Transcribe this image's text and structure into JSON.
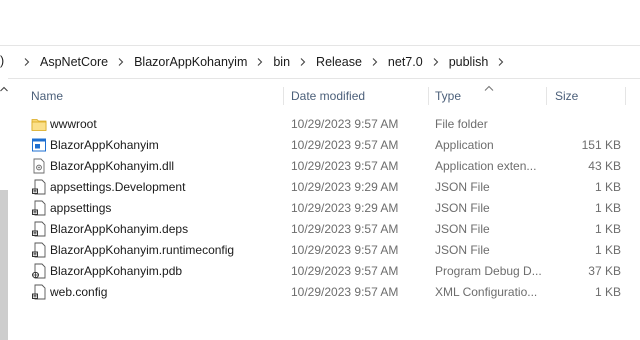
{
  "breadcrumb": {
    "lead": ")",
    "items": [
      "AspNetCore",
      "BlazorAppKohanyim",
      "bin",
      "Release",
      "net7.0",
      "publish"
    ]
  },
  "columns": {
    "name": "Name",
    "date": "Date modified",
    "type": "Type",
    "size": "Size"
  },
  "files": [
    {
      "name": "wwwroot",
      "date": "10/29/2023 9:57 AM",
      "type": "File folder",
      "size": "",
      "icon": "folder-icon"
    },
    {
      "name": "BlazorAppKohanyim",
      "date": "10/29/2023 9:57 AM",
      "type": "Application",
      "size": "151 KB",
      "icon": "application-icon"
    },
    {
      "name": "BlazorAppKohanyim.dll",
      "date": "10/29/2023 9:57 AM",
      "type": "Application exten...",
      "size": "43 KB",
      "icon": "dll-icon"
    },
    {
      "name": "appsettings.Development",
      "date": "10/29/2023 9:29 AM",
      "type": "JSON File",
      "size": "1 KB",
      "icon": "json-file-icon"
    },
    {
      "name": "appsettings",
      "date": "10/29/2023 9:29 AM",
      "type": "JSON File",
      "size": "1 KB",
      "icon": "json-file-icon"
    },
    {
      "name": "BlazorAppKohanyim.deps",
      "date": "10/29/2023 9:57 AM",
      "type": "JSON File",
      "size": "1 KB",
      "icon": "json-file-icon"
    },
    {
      "name": "BlazorAppKohanyim.runtimeconfig",
      "date": "10/29/2023 9:57 AM",
      "type": "JSON File",
      "size": "1 KB",
      "icon": "json-file-icon"
    },
    {
      "name": "BlazorAppKohanyim.pdb",
      "date": "10/29/2023 9:57 AM",
      "type": "Program Debug D...",
      "size": "37 KB",
      "icon": "pdb-file-icon"
    },
    {
      "name": "web.config",
      "date": "10/29/2023 9:57 AM",
      "type": "XML Configuratio...",
      "size": "1 KB",
      "icon": "config-file-icon"
    }
  ],
  "colors": {
    "header_text": "#4c607a",
    "secondary_text": "#6d6d6d",
    "folder": "#f8d775",
    "app_blue": "#1e6fd0"
  }
}
